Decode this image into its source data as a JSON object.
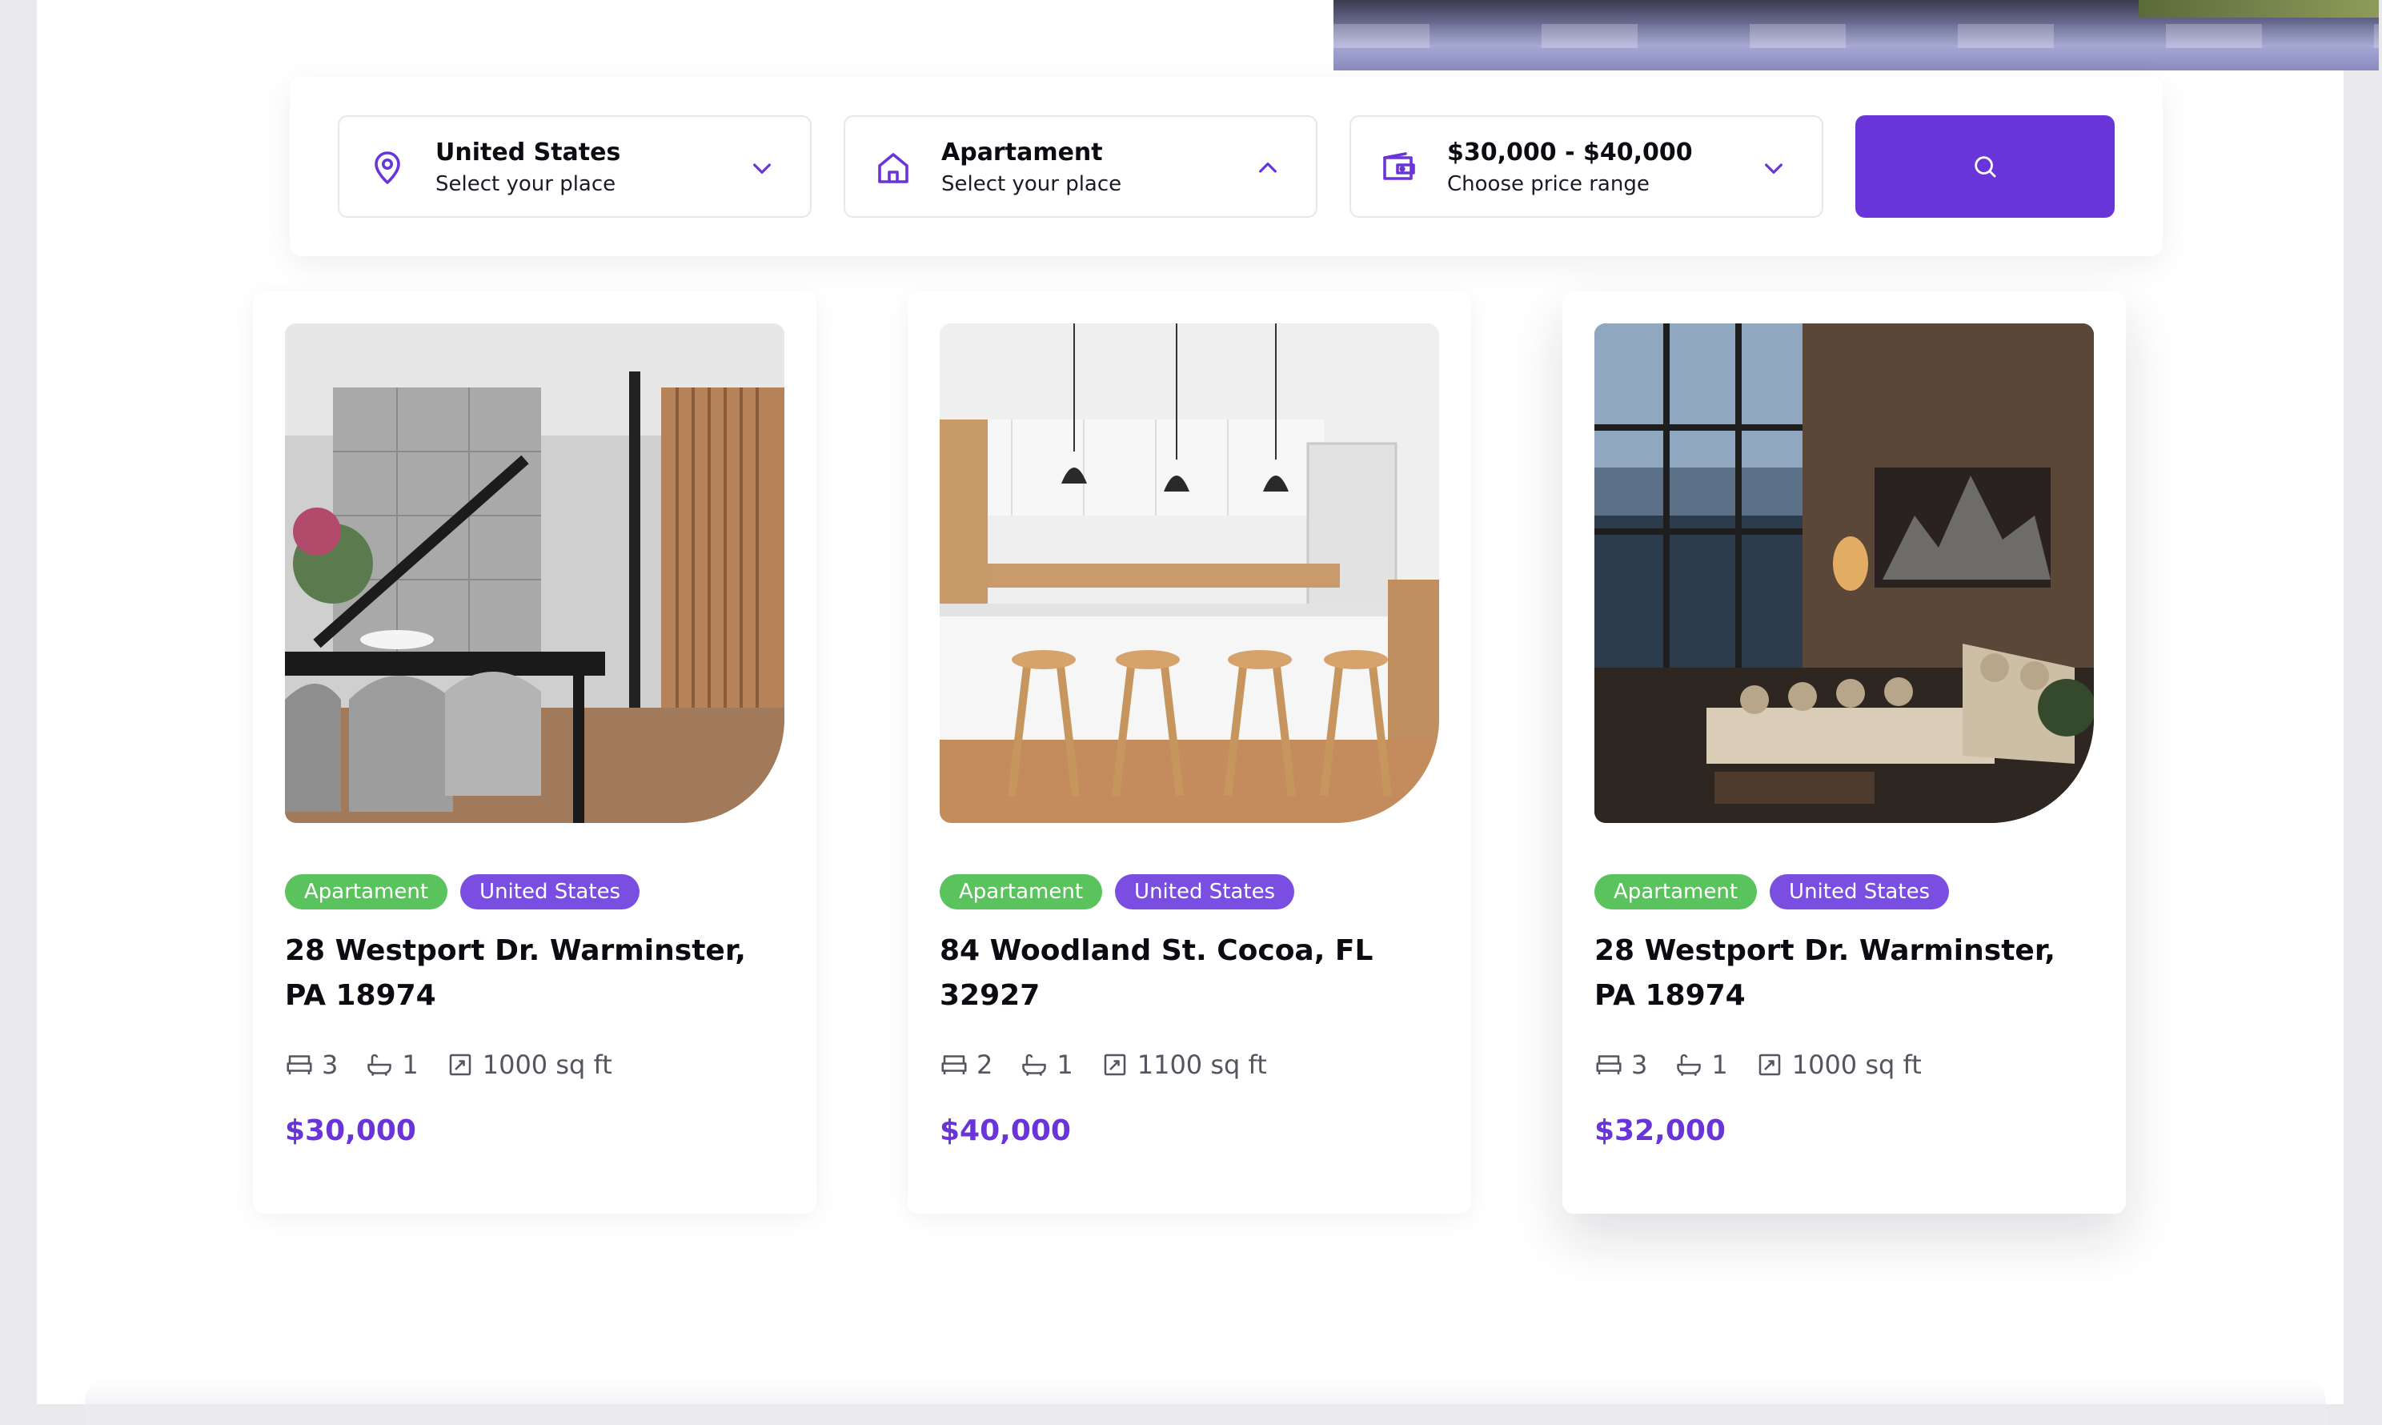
{
  "search": {
    "location": {
      "title": "United States",
      "subtitle": "Select your place",
      "icon": "map-pin-icon",
      "chevron": "chevron-down-icon"
    },
    "property_type": {
      "title": "Apartament",
      "subtitle": "Select your place",
      "icon": "home-icon",
      "chevron": "chevron-up-icon"
    },
    "price": {
      "title": "$30,000 - $40,000",
      "subtitle": "Choose price range",
      "icon": "wallet-icon",
      "chevron": "chevron-down-icon"
    },
    "button_icon": "search-icon"
  },
  "listings": [
    {
      "tags": [
        "Apartament",
        "United States"
      ],
      "title": "28 Westport Dr. Warminster, PA 18974",
      "beds": "3",
      "baths": "1",
      "area": "1000 sq ft",
      "price": "$30,000"
    },
    {
      "tags": [
        "Apartament",
        "United States"
      ],
      "title": "84 Woodland St. Cocoa, FL 32927",
      "beds": "2",
      "baths": "1",
      "area": "1100 sq ft",
      "price": "$40,000"
    },
    {
      "tags": [
        "Apartament",
        "United States"
      ],
      "title": "28 Westport Dr. Warminster, PA 18974",
      "beds": "3",
      "baths": "1",
      "area": "1000 sq ft",
      "price": "$32,000"
    }
  ],
  "colors": {
    "accent": "#6a35d8",
    "tag_green": "#5ac35d",
    "tag_purple": "#7a4ee0"
  }
}
